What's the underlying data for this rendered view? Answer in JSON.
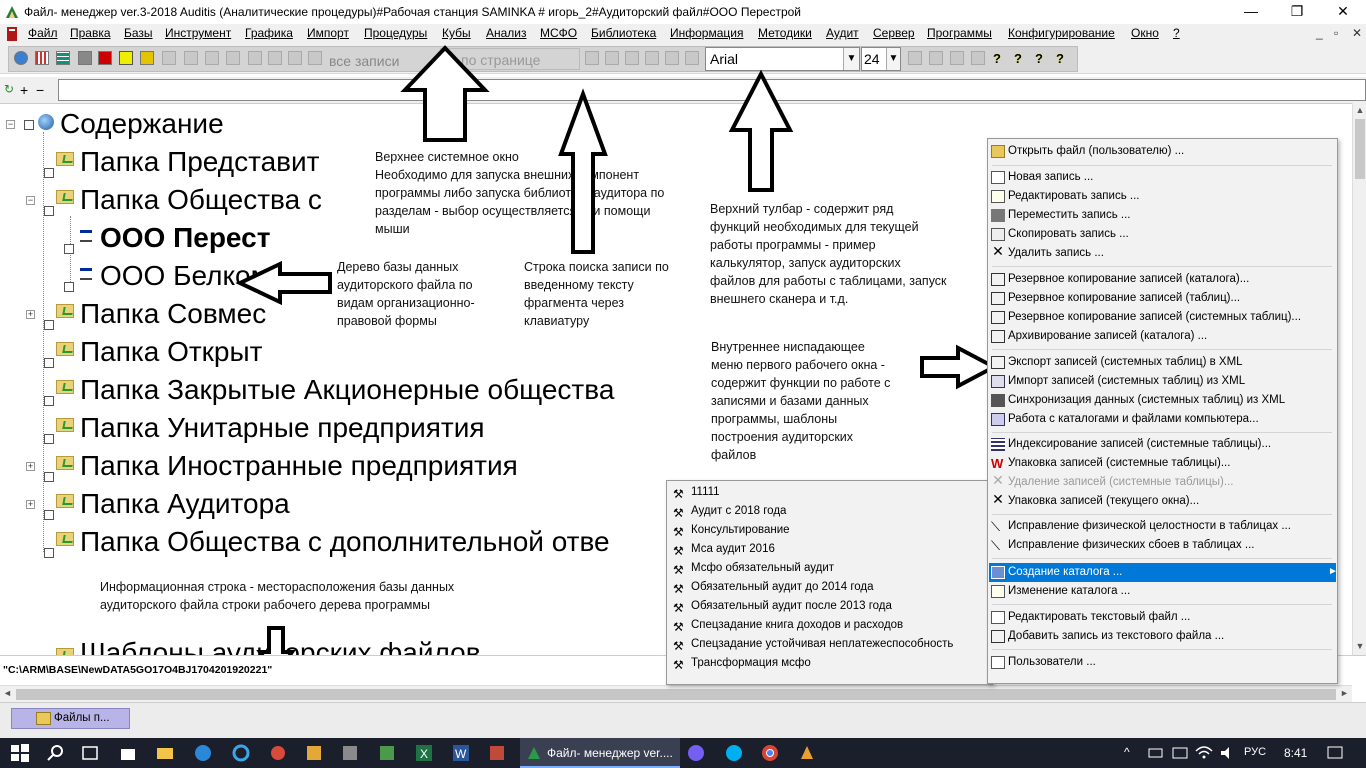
{
  "window": {
    "title": "Файл- менеджер ver.3-2018 Auditis (Аналитические процедуры)#Рабочая станция SAMINKA # игорь_2#Аудиторский файл#ООО Перестрой",
    "minimize": "—",
    "restore": "❐",
    "close": "✕"
  },
  "menu": {
    "items": [
      "Файл",
      "Правка",
      "Базы",
      "Инструмент",
      "Графика",
      "Импорт",
      "Процедуры",
      "Кубы",
      "Анализ",
      "МСФО",
      "Библиотека",
      "Информация",
      "Методики",
      "Аудит",
      "Сервер",
      "Программы",
      "Конфигурирование",
      "Окно",
      "?"
    ],
    "mdi_min": "_",
    "mdi_restore": "▫",
    "mdi_close": "✕"
  },
  "toolbar": {
    "all_records": "все записи",
    "per_page": "по странице",
    "font_name": "Arial",
    "font_size": "24",
    "help_marks": [
      "?",
      "?",
      "?",
      "?"
    ]
  },
  "searchrow": {
    "plus": "+",
    "minus": "−"
  },
  "tree": {
    "root": "Содержание",
    "nodes": [
      "Папка Представит",
      "Папка Общества с",
      "ООО Перест",
      "ООО Белком",
      "Папка Совмес",
      "Папка Открыт",
      "Папка Закрытые Акционерные общества",
      "Папка Унитарные предприятия",
      "Папка Иностранные предприятия",
      "Папка Аудитора",
      "Папка Общества с дополнительной отве",
      "Шаблоны аудиторских файлов"
    ],
    "expand_plus": "+",
    "expand_minus": "−"
  },
  "notes": {
    "top_window": "Верхнее системное окно\nНеобходимо для запуска внешних компонент\nпрограммы либо запуска библиотеки аудитора по\nразделам - выбор осуществляется при помощи\nмыши",
    "toolbar": "Верхний тулбар - содержит ряд\nфункций необходимых для текущей\nработы программы - пример\nкалькулятор, запуск аудиторских\nфайлов для работы с таблицами, запуск\nвнешнего сканера и т.д.",
    "tree": "Дерево базы данных\nаудиторского файла по\nвидам организационно-\nправовой формы",
    "search": "Строка поиска записи по\nвведенному тексту\nфрагмента через\nклавиатуру",
    "inner_menu": "Внутреннее ниспадающее\nменю первого рабочего окна -\nсодержит функции по работе с\nзаписями и базами данных\nпрограммы, шаблоны\nпостроения аудиторских\nфайлов",
    "info_line": "Информационная строка - месторасположения базы данных\nаудиторского файла строки рабочего дерева программы"
  },
  "status": {
    "path": "\"C:\\ARM\\BASE\\NewDATA5GO17O4BJ1704201920221\""
  },
  "mdi": {
    "files_button": "Файлы п..."
  },
  "taskbar": {
    "active_app": "Файл- менеджер ver....",
    "lang": "РУС",
    "clock": "8:41"
  },
  "context_menu": {
    "items": [
      "Открыть файл (пользователю) ...",
      "Новая запись ...",
      "Редактировать запись ...",
      "Переместить запись ...",
      "Скопировать запись  ...",
      "Удалить запись  ...",
      "Резервное копирование записей (каталога)...",
      "Резервное копирование записей (таблиц)...",
      "Резервное копирование записей (системных таблиц)...",
      "Архивирование записей (каталога) ...",
      "Экспорт записей (системных таблиц) в XML",
      "Импорт записей (системных таблиц) из XML",
      "Синхронизация данных (системных таблиц) из XML",
      "Работа с каталогами и файлами компьютера...",
      "Индексирование записей (системные таблицы)...",
      "Упаковка записей (системные таблицы)...",
      "Удаление записей (системные таблицы)...",
      "Упаковка записей (текущего окна)...",
      "Исправление физической целостности в таблицах ...",
      "Исправление физических сбоев в таблицах ...",
      "Создание каталога ...",
      "Изменение каталога ...",
      "Редактировать текстовый файл ...",
      "Добавить запись из текстового файла ...",
      "Пользователи ..."
    ],
    "submenu_arrow": "►"
  },
  "submenu": {
    "items": [
      "11111",
      "Аудит с 2018 года",
      "Консультирование",
      "Мса аудит 2016",
      "Мсфо обязательный аудит",
      "Обязательный аудит до 2014 года",
      "Обязательный аудит после 2013 года",
      "Спецзадание книга доходов и расходов",
      "Спецзадание устойчивая неплатежеспособность",
      "Трансформация мсфо"
    ]
  },
  "colors": {
    "menu_highlight": "#0078d7",
    "taskbar": "#1b1f2b",
    "mdi_button": "#b8b4e8"
  }
}
